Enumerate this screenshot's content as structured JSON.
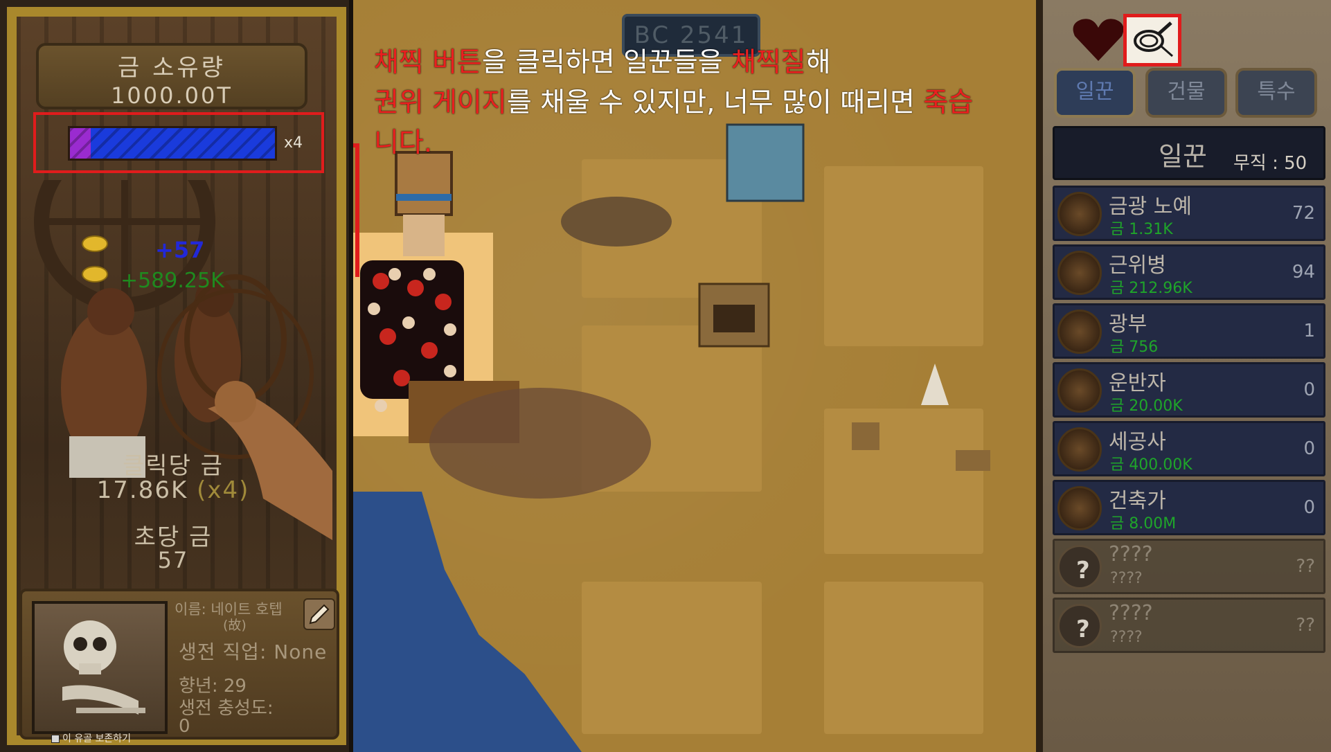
{
  "left_panel": {
    "gold_title": "금 소유량",
    "gold_value": "1000.00T",
    "gauge_multiplier": "x4",
    "gauge_fill_fraction": 0.1,
    "plus_workers": "+57",
    "plus_gold": "+589.25K",
    "click_gold_label": "클릭당 금",
    "click_gold_value": "17.86K",
    "click_gold_mult": "(x4)",
    "sec_gold_label": "초당 금",
    "sec_gold_value": "57",
    "relic": {
      "name": "이름: 네이트 호텝",
      "name_suffix": "(故)",
      "job": "생전 직업: None",
      "age": "향년: 29",
      "loyalty_label": "생전 충성도:",
      "loyalty_value": "0",
      "keep_label": "이 유골 보존하기"
    }
  },
  "map": {
    "era": "BC 2541",
    "tutorial": {
      "line1": [
        {
          "text": "채찍 버튼",
          "red": true
        },
        {
          "text": "을 클릭하면 일꾼들을 ",
          "red": false
        },
        {
          "text": "채찍질",
          "red": true
        },
        {
          "text": "해",
          "red": false
        }
      ],
      "line2": [
        {
          "text": "권위 게이지",
          "red": true
        },
        {
          "text": "를 채울 수 있지만, 너무 많이 때리면 ",
          "red": false
        },
        {
          "text": "죽습니다.",
          "red": true
        }
      ]
    }
  },
  "right_panel": {
    "tabs": [
      "일꾼",
      "건물",
      "특수"
    ],
    "workers_title": "일꾼",
    "unemployed": "무직 : 50",
    "workers": [
      {
        "name": "금광 노예",
        "cost": "금 1.31K",
        "count": "72",
        "icon": "pickaxe-icon"
      },
      {
        "name": "근위병",
        "cost": "금 212.96K",
        "count": "94",
        "icon": "spear-icon"
      },
      {
        "name": "광부",
        "cost": "금 756",
        "count": "1",
        "icon": "cart-icon"
      },
      {
        "name": "운반자",
        "cost": "금 20.00K",
        "count": "0",
        "icon": "crate-icon"
      },
      {
        "name": "세공사",
        "cost": "금 400.00K",
        "count": "0",
        "icon": "gold-bars-icon"
      },
      {
        "name": "건축가",
        "cost": "금 8.00M",
        "count": "0",
        "icon": "blueprint-icon"
      }
    ],
    "locked_workers": [
      {
        "name": "????",
        "cost": "????",
        "count": "??"
      },
      {
        "name": "????",
        "cost": "????",
        "count": "??"
      }
    ]
  },
  "colors": {
    "highlight_red": "#e01c1c",
    "gauge_blue": "#1a3bdc",
    "gauge_purple": "#9a2bd0",
    "cost_green": "#1fa52a"
  }
}
